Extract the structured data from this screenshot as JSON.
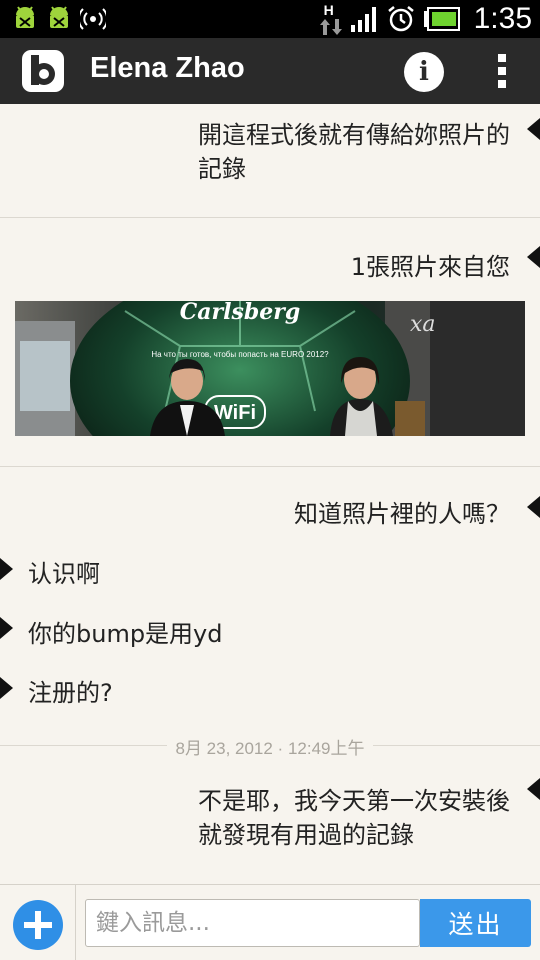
{
  "status_bar": {
    "time": "1:35",
    "network_type": "H",
    "icons": [
      "android-debug-icon",
      "android-debug-icon",
      "hotspot-icon",
      "data-arrows-icon",
      "signal-icon",
      "alarm-icon",
      "battery-icon"
    ]
  },
  "app_bar": {
    "title": "Elena Zhao",
    "info_label": "i"
  },
  "messages": [
    {
      "direction": "out",
      "text_line1": "開這程式後就有傳給妳照片的",
      "text_line2": "記錄"
    },
    {
      "direction": "out",
      "text": "1張照片來自您",
      "has_photo": true
    },
    {
      "direction": "out",
      "text": "知道照片裡的人嗎？"
    },
    {
      "direction": "in",
      "text": "认识啊"
    },
    {
      "direction": "in",
      "text": "你的bump是用yd"
    },
    {
      "direction": "in",
      "text": "注册的?"
    },
    {
      "direction": "out",
      "text_line1": "不是耶，我今天第一次安裝後",
      "text_line2": "就發現有用過的記錄"
    }
  ],
  "timestamp": "8月 23, 2012 · 12:49上午",
  "photo": {
    "sign_text": "Carlsberg",
    "wifi_text": "WiFi",
    "poster_text": "На что ты готов, чтобы попасть на EURO 2012?",
    "store_text": "xa"
  },
  "input": {
    "placeholder": "鍵入訊息...",
    "value": "",
    "send_label": "送出"
  },
  "colors": {
    "status_bar": "#000000",
    "app_bar": "#2a2a2a",
    "chat_background": "#f7f4ee",
    "accent_blue": "#3b98ea",
    "battery_green": "#6fd32f"
  }
}
